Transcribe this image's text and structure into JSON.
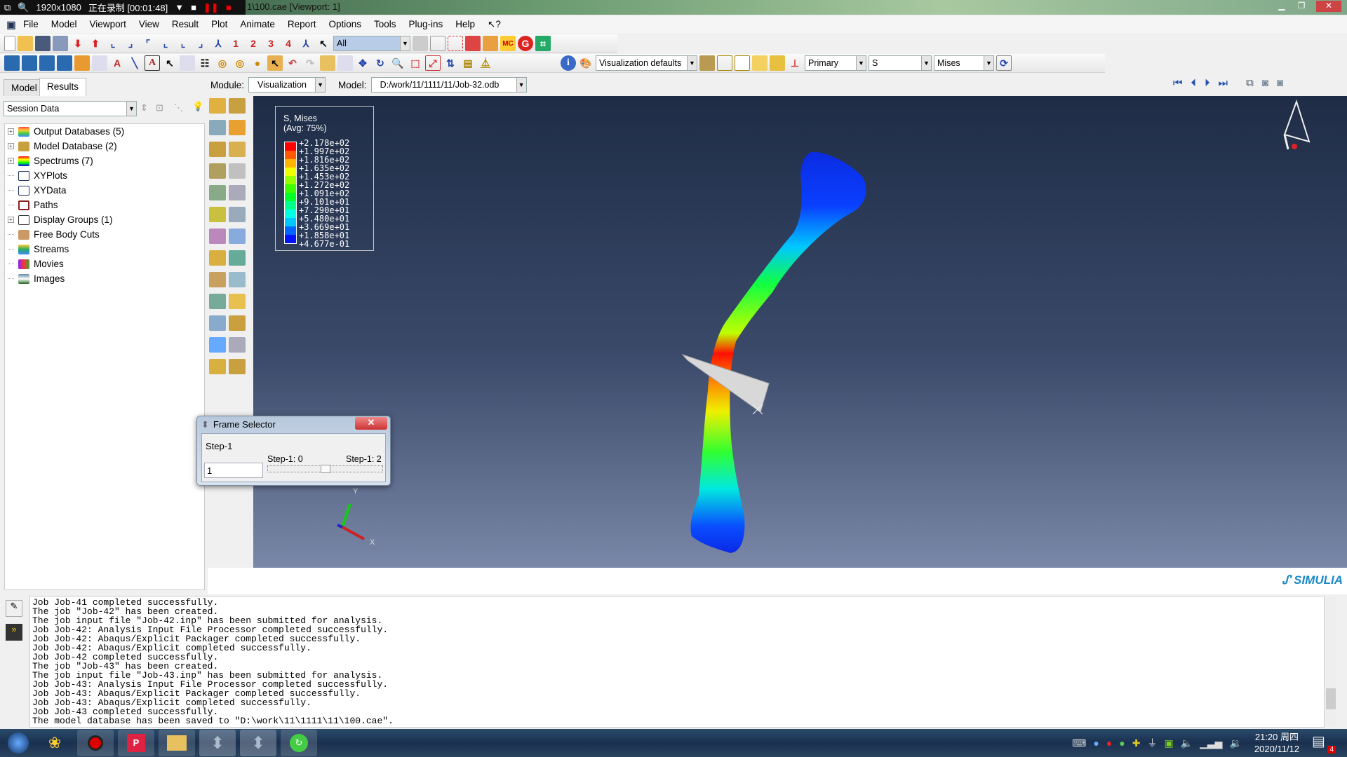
{
  "recorder": {
    "resolution": "1920x1080",
    "status": "正在录制 [00:01:48]"
  },
  "window": {
    "title": "1\\100.cae [Viewport: 1]"
  },
  "menu": [
    "File",
    "Model",
    "Viewport",
    "View",
    "Result",
    "Plot",
    "Animate",
    "Report",
    "Options",
    "Tools",
    "Plug-ins",
    "Help",
    "↖?"
  ],
  "toolbar1": {
    "numbers": [
      "1",
      "2",
      "3",
      "4"
    ],
    "selection_filter": "All"
  },
  "toolbar2": {
    "render_style": "Visualization defaults",
    "field_type": "Primary",
    "field": "S",
    "invariant": "Mises"
  },
  "module_row": {
    "module_label": "Module:",
    "module_value": "Visualization",
    "model_label": "Model:",
    "model_value": "D:/work/11/1111/11/Job-32.odb"
  },
  "left_panel": {
    "tabs": [
      "Model",
      "Results"
    ],
    "active_tab": "Results",
    "session_select": "Session Data",
    "tree": [
      {
        "label": "Output Databases (5)",
        "expandable": true,
        "icon": "output-database-icon"
      },
      {
        "label": "Model Database (2)",
        "expandable": true,
        "icon": "model-database-icon"
      },
      {
        "label": "Spectrums (7)",
        "expandable": true,
        "icon": "spectrum-icon"
      },
      {
        "label": "XYPlots",
        "expandable": false,
        "icon": "xyplot-icon"
      },
      {
        "label": "XYData",
        "expandable": false,
        "icon": "xydata-icon"
      },
      {
        "label": "Paths",
        "expandable": false,
        "icon": "path-icon"
      },
      {
        "label": "Display Groups (1)",
        "expandable": true,
        "icon": "display-group-icon"
      },
      {
        "label": "Free Body Cuts",
        "expandable": false,
        "icon": "free-body-cut-icon"
      },
      {
        "label": "Streams",
        "expandable": false,
        "icon": "stream-icon"
      },
      {
        "label": "Movies",
        "expandable": false,
        "icon": "movie-icon"
      },
      {
        "label": "Images",
        "expandable": false,
        "icon": "image-icon"
      }
    ]
  },
  "legend": {
    "title": "S, Mises",
    "subtitle": "(Avg: 75%)",
    "values": [
      "+2.178e+02",
      "+1.997e+02",
      "+1.816e+02",
      "+1.635e+02",
      "+1.453e+02",
      "+1.272e+02",
      "+1.091e+02",
      "+9.101e+01",
      "+7.290e+01",
      "+5.480e+01",
      "+3.669e+01",
      "+1.858e+01",
      "+4.677e-01"
    ],
    "colors": [
      "#ff0000",
      "#ff5a00",
      "#ffb400",
      "#f0ff00",
      "#96ff00",
      "#3cff00",
      "#00ff28",
      "#00ff8c",
      "#00ffe6",
      "#00c8ff",
      "#0064ff",
      "#0014ff"
    ]
  },
  "triad": {
    "y": "Y",
    "x": "X"
  },
  "frame_selector": {
    "title": "Frame Selector",
    "step": "Step-1",
    "frame_value": "1",
    "min_label": "Step-1: 0",
    "max_label": "Step-1: 2",
    "slider_position": 0.5
  },
  "brand": "SIMULIA",
  "console": [
    "Job Job-41 completed successfully.",
    "The job \"Job-42\" has been created.",
    "The job input file \"Job-42.inp\" has been submitted for analysis.",
    "Job Job-42: Analysis Input File Processor completed successfully.",
    "Job Job-42: Abaqus/Explicit Packager completed successfully.",
    "Job Job-42: Abaqus/Explicit completed successfully.",
    "Job Job-42 completed successfully.",
    "The job \"Job-43\" has been created.",
    "The job input file \"Job-43.inp\" has been submitted for analysis.",
    "Job Job-43: Analysis Input File Processor completed successfully.",
    "Job Job-43: Abaqus/Explicit Packager completed successfully.",
    "Job Job-43: Abaqus/Explicit completed successfully.",
    "Job Job-43 completed successfully.",
    "The model database has been saved to \"D:\\work\\11\\1111\\11\\100.cae\"."
  ],
  "taskbar": {
    "time": "21:20 周四",
    "date": "2020/11/12",
    "notification_count": "4"
  }
}
